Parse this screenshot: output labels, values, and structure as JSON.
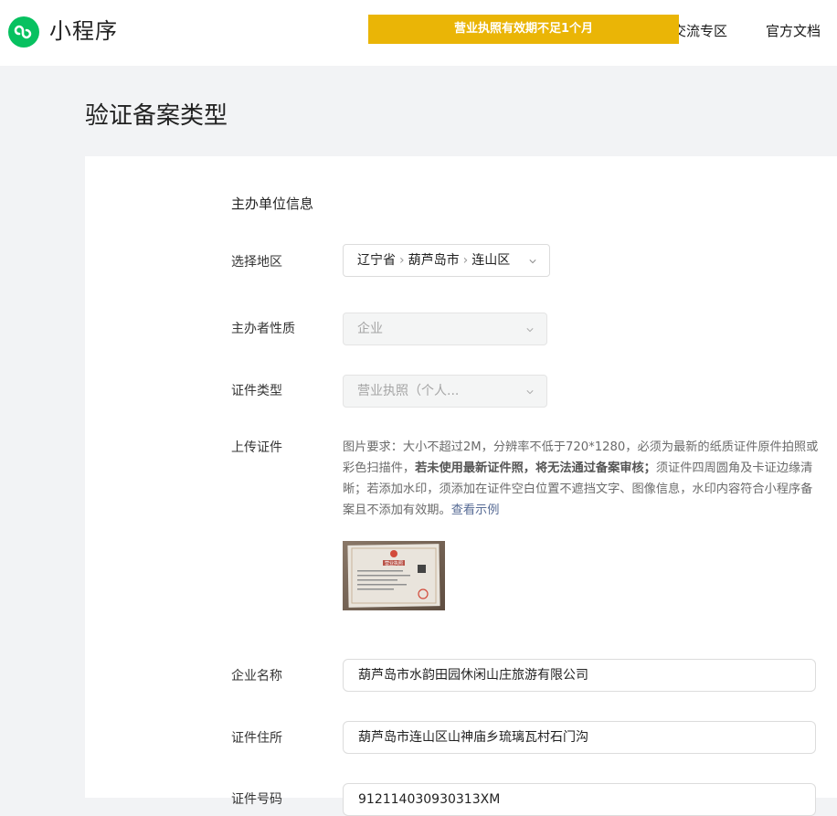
{
  "header": {
    "logo_text": "小程序",
    "nav": [
      "交流专区",
      "官方文档"
    ],
    "banner": "营业执照有效期不足1个月"
  },
  "page": {
    "title": "验证备案类型"
  },
  "form": {
    "section_title": "主办单位信息",
    "region": {
      "label": "选择地区",
      "province": "辽宁省",
      "city": "葫芦岛市",
      "district": "连山区"
    },
    "nature": {
      "label": "主办者性质",
      "value": "企业"
    },
    "cert_type": {
      "label": "证件类型",
      "value": "营业执照（个人..."
    },
    "upload": {
      "label": "上传证件",
      "desc_part1": "图片要求：大小不超过2M，分辨率不低于720*1280，必须为最新的纸质证件原件拍照或彩色扫描件，",
      "desc_bold": "若未使用最新证件照，将无法通过备案审核；",
      "desc_part2": "须证件四周圆角及卡证边缘清晰；若添加水印，须添加在证件空白位置不遮挡文字、图像信息，水印内容符合小程序备案且不添加有效期。",
      "example_link": "查看示例",
      "image_title": "营业执照"
    },
    "company_name": {
      "label": "企业名称",
      "value": "葫芦岛市水韵田园休闲山庄旅游有限公司"
    },
    "address": {
      "label": "证件住所",
      "value": "葫芦岛市连山区山神庙乡琉璃瓦村石门沟"
    },
    "cert_number": {
      "label": "证件号码",
      "value": "912114030930313XM"
    }
  }
}
